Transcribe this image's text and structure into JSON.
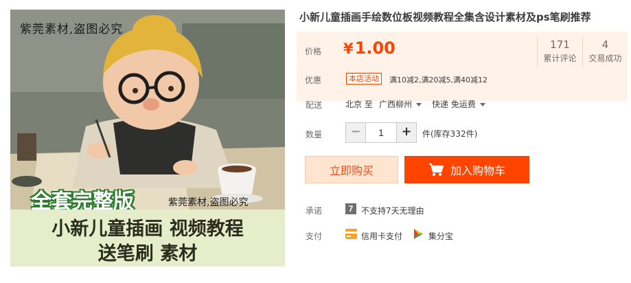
{
  "product_image": {
    "watermark_top": "紫莞素材,盗图必究",
    "watermark_bottom": "紫莞素材,盗图必究",
    "badge": "全套完整版",
    "banner_line1": "小新儿童插画 视频教程",
    "banner_line2": "送笔刷 素材"
  },
  "title": "小新儿童插画手绘数位板视频教程全集含设计素材及ps笔刷推荐",
  "price": {
    "label": "价格",
    "currency": "¥",
    "value": "1.00"
  },
  "stats": [
    {
      "num": "171",
      "label": "累计评论"
    },
    {
      "num": "4",
      "label": "交易成功"
    }
  ],
  "promo": {
    "label": "优惠",
    "tag": "本店活动",
    "text": "满10减2,满20减5,满40减12"
  },
  "shipping": {
    "label": "配送",
    "from": "北京 至",
    "city": "广西柳州",
    "method": "快递 免运费"
  },
  "quantity": {
    "label": "数量",
    "minus": "−",
    "plus": "+",
    "value": "1",
    "stock": "件(库存332件)"
  },
  "buttons": {
    "buy_now": "立即购买",
    "add_cart": "加入购物车"
  },
  "promise": {
    "label": "承诺",
    "icon_glyph": "7",
    "text": "不支持7天无理由"
  },
  "payment": {
    "label": "支付",
    "credit": "信用卡支付",
    "jfb": "集分宝"
  },
  "colors": {
    "accent": "#ff4400",
    "price_bg": "#fff2e8",
    "buy_now_bg": "#ffe4d0",
    "banner_bg": "#e6edcb"
  }
}
